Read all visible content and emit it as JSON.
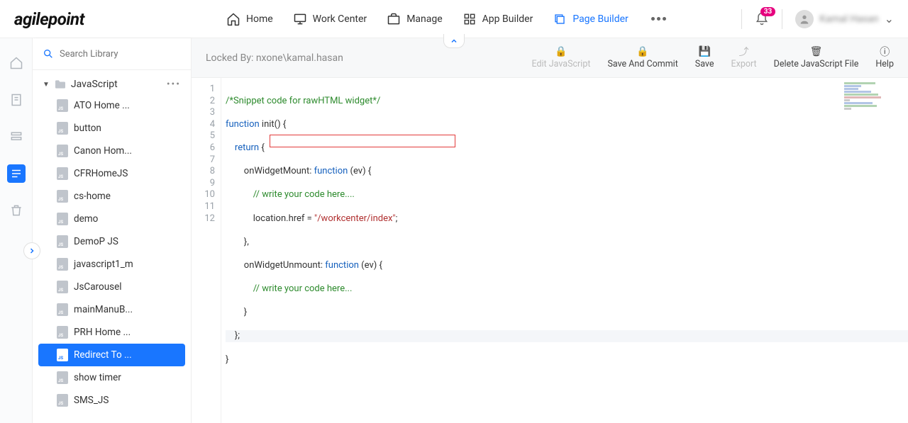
{
  "logo": "agilepoint",
  "nav": {
    "home": "Home",
    "work_center": "Work Center",
    "manage": "Manage",
    "app_builder": "App Builder",
    "page_builder": "Page Builder"
  },
  "notifications": {
    "count": "33"
  },
  "user": {
    "name": "Kamal Hasan"
  },
  "search": {
    "placeholder": "Search Library"
  },
  "tree": {
    "root_label": "JavaScript",
    "items": [
      "ATO Home ...",
      "button",
      "Canon Hom...",
      "CFRHomeJS",
      "cs-home",
      "demo",
      "DemoP JS",
      "javascript1_m",
      "JsCarousel",
      "mainManuB...",
      "PRH Home ...",
      "Redirect To ...",
      "show timer",
      "SMS_JS"
    ],
    "selected_index": 11
  },
  "toolbar": {
    "locked_prefix": "Locked By: ",
    "locked_user": "nxone\\kamal.hasan",
    "edit_js": "Edit JavaScript",
    "save_commit": "Save And Commit",
    "save": "Save",
    "export": "Export",
    "delete_js": "Delete JavaScript File",
    "help": "Help"
  },
  "code": {
    "line_count": 12,
    "lines": {
      "l1_comment": "/*Snippet code for rawHTML widget*/",
      "l2_kw": "function",
      "l2_rest": " init() {",
      "l3_kw": "return",
      "l3_rest": " {",
      "l4_a": "        onWidgetMount: ",
      "l4_fn": "function",
      "l4_b": " (ev) {",
      "l5_comment": "            // write your code here....",
      "l6_a": "            location.href = ",
      "l6_str": "\"/workcenter/index\"",
      "l6_b": ";",
      "l7": "        },",
      "l8_a": "        onWidgetUnmount: ",
      "l8_fn": "function",
      "l8_b": " (ev) {",
      "l9_comment": "            // write your code here...",
      "l10": "        }",
      "l11": "    };",
      "l12": "}"
    }
  }
}
